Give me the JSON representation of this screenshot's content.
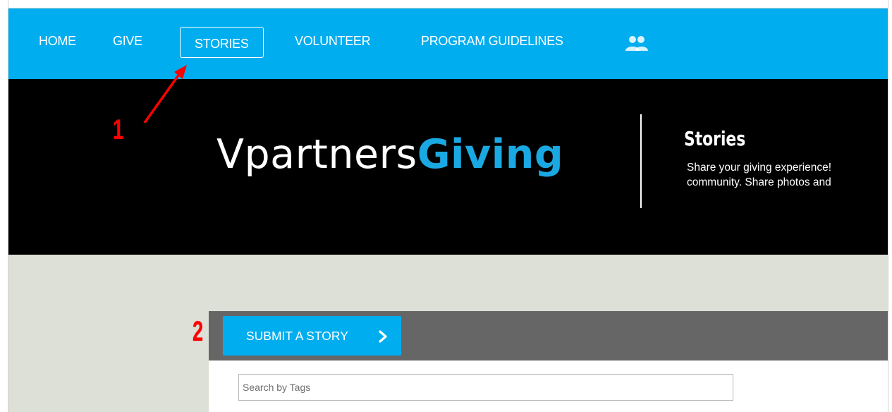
{
  "nav": {
    "items": [
      {
        "label": "HOME"
      },
      {
        "label": "GIVE"
      },
      {
        "label": "STORIES",
        "active": true
      },
      {
        "label": "VOLUNTEER"
      },
      {
        "label": "PROGRAM GUIDELINES"
      }
    ],
    "community_icon": "people-icon"
  },
  "hero": {
    "brand_plain": "Vpartners",
    "brand_accent": "Giving",
    "title": "Stories",
    "description_line1": "Share your giving experience!",
    "description_line2": "community.  Share photos and"
  },
  "annotations": {
    "marker1": "1",
    "marker2": "2"
  },
  "stories": {
    "submit_label": "SUBMIT A STORY",
    "search_placeholder": "Search by Tags",
    "search_value": ""
  },
  "colors": {
    "nav_bg": "#00adee",
    "brand_accent": "#1aa8e2",
    "annotation": "#ff0000",
    "story_bar": "#666666",
    "page_bg": "#dde0d6"
  }
}
